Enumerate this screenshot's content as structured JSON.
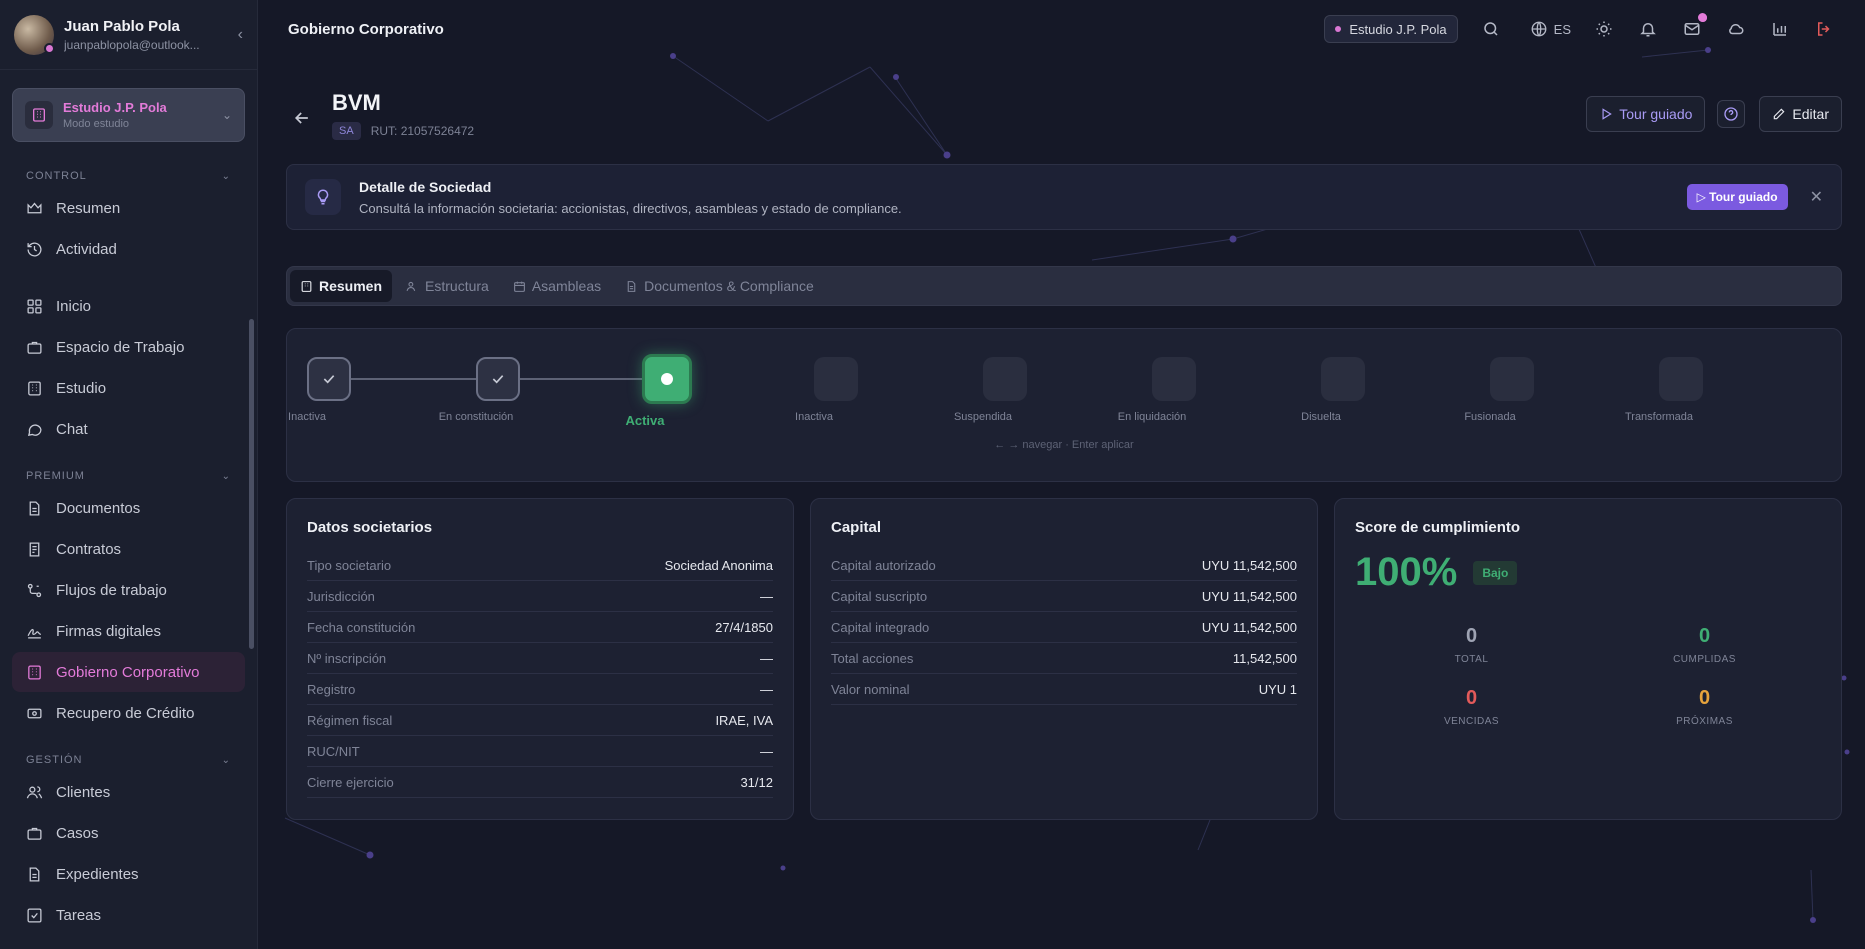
{
  "user": {
    "name": "Juan Pablo Pola",
    "email": "juanpablopola@outlook..."
  },
  "workspace": {
    "name": "Estudio J.P. Pola",
    "mode": "Modo estudio"
  },
  "sidebar": {
    "sections": [
      {
        "title": "CONTROL",
        "items": [
          {
            "label": "Resumen",
            "icon": "crown-icon"
          },
          {
            "label": "Actividad",
            "icon": "history-icon"
          }
        ]
      },
      {
        "title": "",
        "items": [
          {
            "label": "Inicio",
            "icon": "grid-icon"
          },
          {
            "label": "Espacio de Trabajo",
            "icon": "briefcase-icon"
          },
          {
            "label": "Estudio",
            "icon": "building-icon"
          },
          {
            "label": "Chat",
            "icon": "chat-icon"
          }
        ]
      },
      {
        "title": "PREMIUM",
        "items": [
          {
            "label": "Documentos",
            "icon": "document-icon"
          },
          {
            "label": "Contratos",
            "icon": "contract-icon"
          },
          {
            "label": "Flujos de trabajo",
            "icon": "workflow-icon"
          },
          {
            "label": "Firmas digitales",
            "icon": "signature-icon"
          },
          {
            "label": "Gobierno Corporativo",
            "icon": "building-icon",
            "active": true
          },
          {
            "label": "Recupero de Crédito",
            "icon": "money-icon"
          }
        ]
      },
      {
        "title": "GESTIÓN",
        "items": [
          {
            "label": "Clientes",
            "icon": "users-icon"
          },
          {
            "label": "Casos",
            "icon": "briefcase-icon"
          },
          {
            "label": "Expedientes",
            "icon": "document-icon"
          },
          {
            "label": "Tareas",
            "icon": "check-icon"
          }
        ]
      }
    ]
  },
  "header": {
    "title": "Gobierno Corporativo",
    "workspace_chip": "Estudio J.P. Pola",
    "language": "ES"
  },
  "entity": {
    "name": "BVM",
    "type_badge": "SA",
    "rut": "RUT: 21057526472"
  },
  "actions": {
    "tour": "Tour guiado",
    "edit": "Editar"
  },
  "hint": {
    "title": "Detalle de Sociedad",
    "description": "Consultá la información societaria: accionistas, directivos, asambleas y estado de compliance.",
    "button": "Tour guiado"
  },
  "tabs": [
    {
      "label": "Resumen",
      "active": true
    },
    {
      "label": "Estructura"
    },
    {
      "label": "Asambleas"
    },
    {
      "label": "Documentos & Compliance"
    }
  ],
  "stepper": {
    "steps": [
      {
        "label": "Inactiva",
        "state": "done"
      },
      {
        "label": "En constitución",
        "state": "done"
      },
      {
        "label": "Activa",
        "state": "current"
      },
      {
        "label": "Inactiva",
        "state": "pending"
      },
      {
        "label": "Suspendida",
        "state": "pending"
      },
      {
        "label": "En liquidación",
        "state": "pending"
      },
      {
        "label": "Disuelta",
        "state": "pending"
      },
      {
        "label": "Fusionada",
        "state": "pending"
      },
      {
        "label": "Transformada",
        "state": "pending"
      }
    ],
    "hint": "← → navegar · Enter aplicar"
  },
  "datos": {
    "title": "Datos societarios",
    "rows": [
      {
        "k": "Tipo societario",
        "v": "Sociedad Anonima"
      },
      {
        "k": "Jurisdicción",
        "v": "—"
      },
      {
        "k": "Fecha constitución",
        "v": "27/4/1850"
      },
      {
        "k": "Nº inscripción",
        "v": "—"
      },
      {
        "k": "Registro",
        "v": "—"
      },
      {
        "k": "Régimen fiscal",
        "v": "IRAE, IVA"
      },
      {
        "k": "RUC/NIT",
        "v": "—"
      },
      {
        "k": "Cierre ejercicio",
        "v": "31/12"
      }
    ]
  },
  "capital": {
    "title": "Capital",
    "rows": [
      {
        "k": "Capital autorizado",
        "v": "UYU 11,542,500"
      },
      {
        "k": "Capital suscripto",
        "v": "UYU 11,542,500"
      },
      {
        "k": "Capital integrado",
        "v": "UYU 11,542,500"
      },
      {
        "k": "Total acciones",
        "v": "11,542,500"
      },
      {
        "k": "Valor nominal",
        "v": "UYU 1"
      }
    ]
  },
  "score": {
    "title": "Score de cumplimiento",
    "percent": "100%",
    "risk": "Bajo",
    "stats": [
      {
        "value": "0",
        "label": "TOTAL",
        "color": "#9ea3b3"
      },
      {
        "value": "0",
        "label": "CUMPLIDAS",
        "color": "#3fae74"
      },
      {
        "value": "0",
        "label": "VENCIDAS",
        "color": "#e35a5a"
      },
      {
        "value": "0",
        "label": "PRÓXIMAS",
        "color": "#e7a33c"
      }
    ]
  },
  "colors": {
    "accent": "#e37bd9",
    "brand_purple": "#7b5ae0",
    "success": "#3fae74",
    "danger": "#e35a5a",
    "warning": "#e7a33c"
  }
}
